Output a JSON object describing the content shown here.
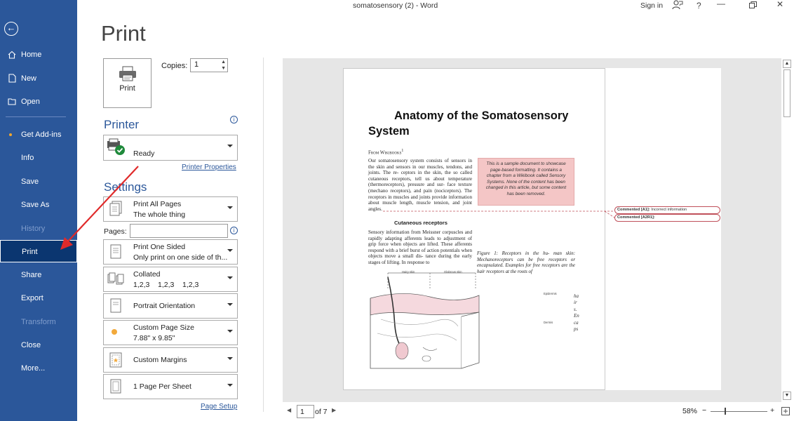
{
  "titlebar": {
    "doc_title": "somatosensory (2)  -  Word",
    "signin": "Sign in",
    "help": "?"
  },
  "sidebar": {
    "back_icon": "back-arrow-icon",
    "items": [
      {
        "label": "Home",
        "icon": "home-icon"
      },
      {
        "label": "New",
        "icon": "new-document-icon"
      },
      {
        "label": "Open",
        "icon": "open-folder-icon"
      },
      {
        "label": "Get Add-ins"
      },
      {
        "label": "Info"
      },
      {
        "label": "Save"
      },
      {
        "label": "Save As"
      },
      {
        "label": "History"
      },
      {
        "label": "Print"
      },
      {
        "label": "Share"
      },
      {
        "label": "Export"
      },
      {
        "label": "Transform"
      },
      {
        "label": "Close"
      },
      {
        "label": "More..."
      }
    ],
    "active": "Print",
    "accent": "#2b579a",
    "active_bg": "#0b3670"
  },
  "print_panel": {
    "heading": "Print",
    "print_button": "Print",
    "copies_label": "Copies:",
    "copies_value": "1",
    "printer_heading": "Printer",
    "printer_name": "Ready",
    "printer_properties": "Printer Properties",
    "settings_heading": "Settings",
    "pages_label": "Pages:",
    "pages_value": "",
    "page_setup": "Page Setup",
    "settings": [
      {
        "line1": "Print All Pages",
        "line2": "The whole thing"
      },
      {
        "line1": "Print One Sided",
        "line2": "Only print on one side of th..."
      },
      {
        "line1": "Collated",
        "line2": "1,2,3    1,2,3    1,2,3"
      },
      {
        "line1": "Portrait Orientation",
        "line2": ""
      },
      {
        "line1": "Custom Page Size",
        "line2": "7.88\" x 9.85\""
      },
      {
        "line1": "Custom Margins",
        "line2": ""
      },
      {
        "line1": "1 Page Per Sheet",
        "line2": ""
      }
    ]
  },
  "preview": {
    "heading": "Anatomy of the Somatosensory System",
    "source": "From Wikibooks",
    "source_superscript": "1",
    "body": "Our somatosensory system consists of sensors in the skin and sensors in our muscles, tendons, and joints. The re- ceptors in the skin, the so called cutaneous receptors, tell us about temperature (thermoreceptors), pressure and sur- face texture (mechano receptors), and pain (nociceptors). The receptors in muscles and joints provide information about muscle length, muscle tension, and joint angles.",
    "sample_note": "This is a sample document to showcase page-based formatting. It contains a chapter from a Wikibook called Sensory Systems. None of the content has been changed in this article, but some content has been removed.",
    "subheading": "Cutaneous receptors",
    "sensory_para": "Sensory information from Meissner corpuscles and rapidly adapting afferents leads to adjustment of grip force when objects are lifted. These afferents respond with a brief burst of action potentials when objects move a small dis- tance during the early stages of lifting. In response to",
    "figure_caption": "Figure 1: Receptors in the hu- man skin: Mechanoreceptors can be free receptors or encapsulated. Examples for free receptors are the hair receptors at the roots of",
    "vertical_text": "hairs.Encaps",
    "comments": [
      {
        "label": "Commented [A1]:",
        "text": "Incorrect information"
      },
      {
        "label": "Commented [A2R1]:",
        "text": ""
      }
    ],
    "figure_labels": [
      "Hairy skin",
      "Glabrous skin",
      "Epidermis",
      "Dermis"
    ]
  },
  "bottombar": {
    "page_number": "1",
    "page_total": "of 7",
    "zoom": "58%",
    "zoom_minus": "−",
    "zoom_plus": "+"
  }
}
